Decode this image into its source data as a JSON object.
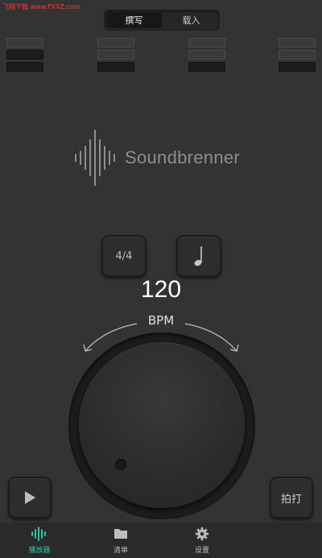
{
  "watermark": "飞翔下载 www.FXXZ.com",
  "mode_tabs": [
    {
      "label": "撰写",
      "active": true
    },
    {
      "label": "载入",
      "active": false
    }
  ],
  "beats": [
    {
      "levels": [
        "off",
        "on",
        "on"
      ]
    },
    {
      "levels": [
        "off",
        "off",
        "on"
      ]
    },
    {
      "levels": [
        "off",
        "off",
        "on"
      ]
    },
    {
      "levels": [
        "off",
        "off",
        "on"
      ]
    }
  ],
  "logo": {
    "text": "Soundbrenner",
    "icon": "soundwave-logo-icon"
  },
  "time_signature": {
    "label": "4/4"
  },
  "subdivision": {
    "icon": "quarter-note-icon"
  },
  "tempo": {
    "value": "120",
    "unit": "BPM"
  },
  "play_button": {
    "icon": "play-icon"
  },
  "tap_button": {
    "label": "拍打"
  },
  "nav": [
    {
      "label": "播放器",
      "icon": "waveform-icon",
      "active": true
    },
    {
      "label": "清单",
      "icon": "folder-icon",
      "active": false
    },
    {
      "label": "设置",
      "icon": "gear-icon",
      "active": false
    }
  ],
  "colors": {
    "accent": "#2ec4a3",
    "background": "#333333",
    "nav_background": "#2a2a2a"
  }
}
